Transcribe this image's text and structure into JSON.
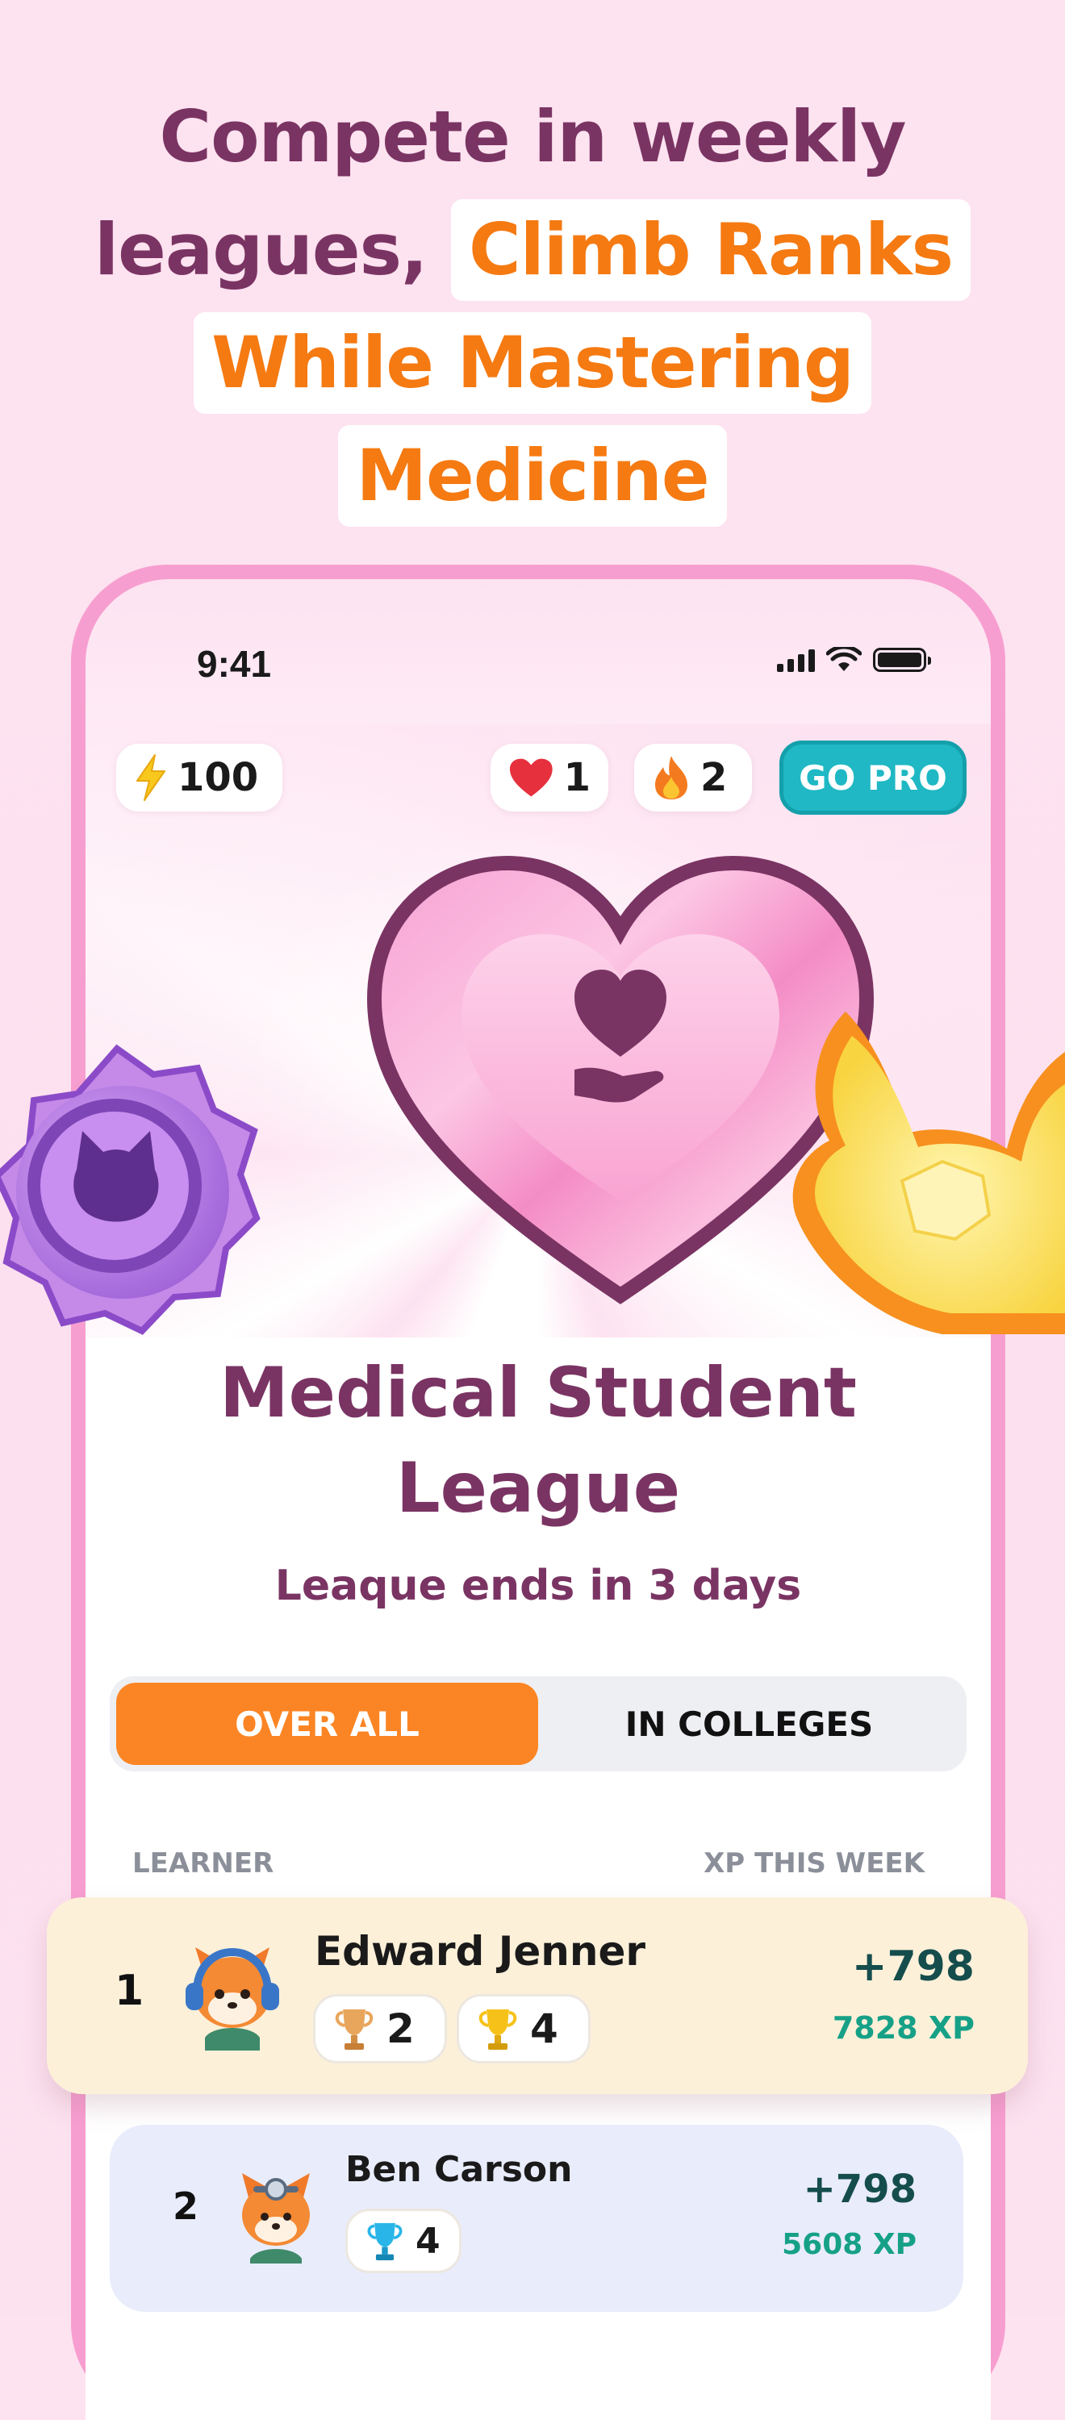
{
  "headline": {
    "line1": "Compete in weekly",
    "line2_plain": "leagues,",
    "line2_highlight": "Climb Ranks",
    "line3_highlight": "While Mastering",
    "line4_highlight": "Medicine"
  },
  "status_bar": {
    "time": "9:41"
  },
  "top_bar": {
    "energy": "100",
    "hearts": "1",
    "streak": "2",
    "go_pro": "GO PRO"
  },
  "league": {
    "title_line1": "Medical Student",
    "title_line2": "League",
    "ends_text": "Leaque ends in 3 days"
  },
  "tabs": [
    {
      "label": "OVER ALL",
      "active": true
    },
    {
      "label": "IN COLLEGES",
      "active": false
    }
  ],
  "leaderboard": {
    "col_learner": "LEARNER",
    "col_xp": "XP THIS WEEK",
    "rows": [
      {
        "rank": "1",
        "name": "Edward Jenner",
        "trophies": [
          {
            "icon": "bronze-trophy-icon",
            "count": "2"
          },
          {
            "icon": "gold-trophy-icon",
            "count": "4"
          }
        ],
        "xp_gain": "+798",
        "xp_total": "7828 XP"
      },
      {
        "rank": "2",
        "name": "Ben Carson",
        "trophies": [
          {
            "icon": "blue-trophy-icon",
            "count": "4"
          }
        ],
        "xp_gain": "+798",
        "xp_total": "5608 XP"
      }
    ]
  },
  "colors": {
    "accent_orange": "#f57a12",
    "title_plum": "#7a3463",
    "go_pro_teal": "#1fb8c4",
    "phone_frame_pink": "#f79ed0"
  }
}
